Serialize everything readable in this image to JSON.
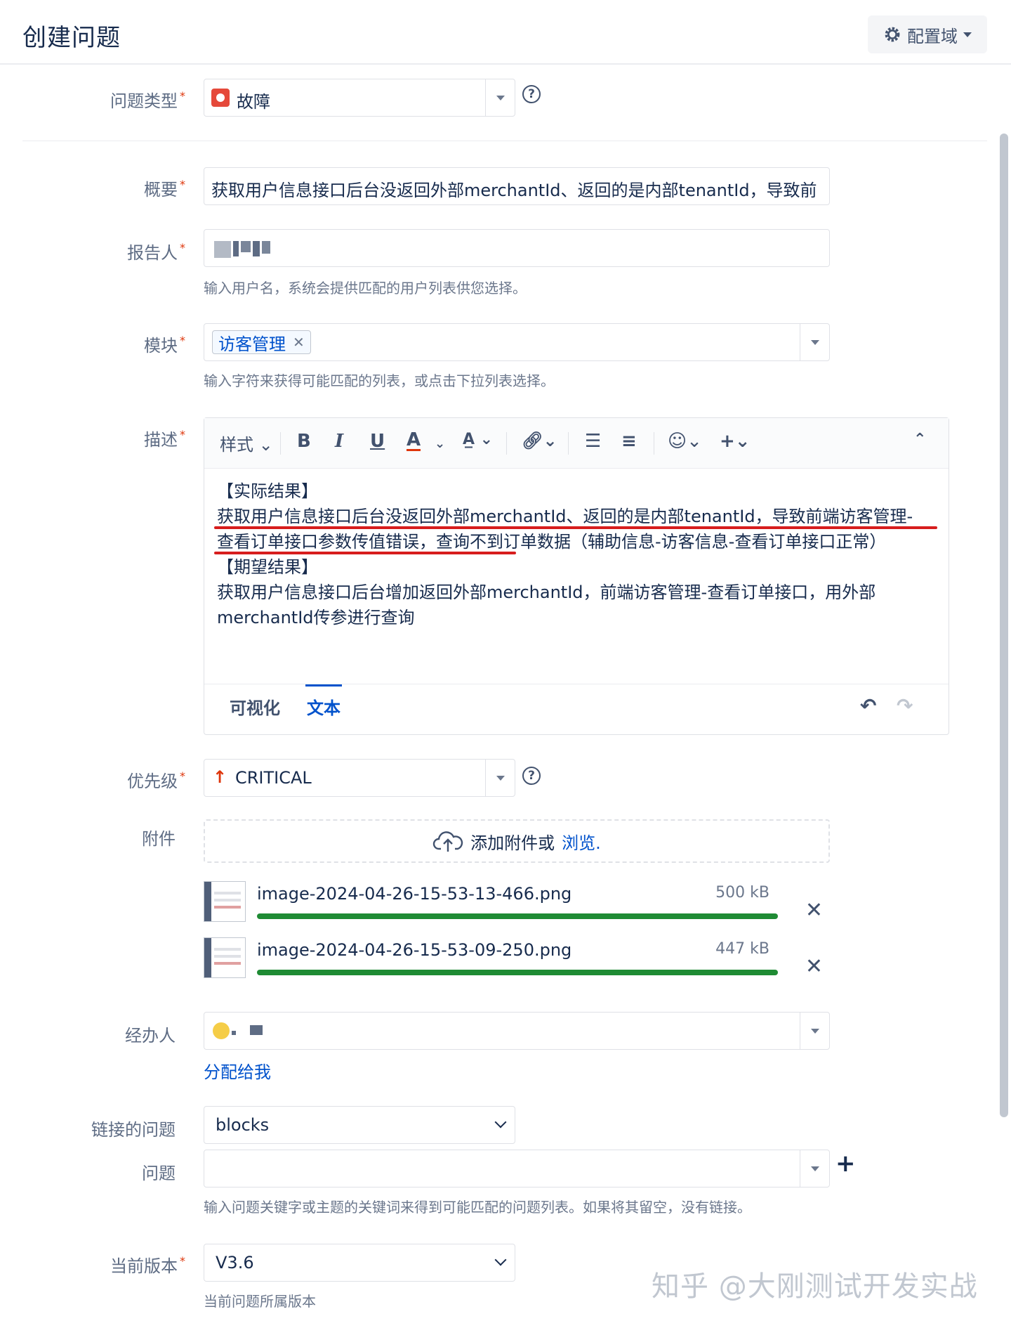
{
  "header": {
    "title": "创建问题",
    "config_label": "配置域"
  },
  "issue_type": {
    "label": "问题类型",
    "value": "故障"
  },
  "summary": {
    "label": "概要",
    "value": "获取用户信息接口后台没返回外部merchantId、返回的是内部tenantId，导致前"
  },
  "reporter": {
    "label": "报告人",
    "hint": "输入用户名，系统会提供匹配的用户列表供您选择。"
  },
  "module": {
    "label": "模块",
    "tag": "访客管理",
    "hint": "输入字符来获得可能匹配的列表，或点击下拉列表选择。"
  },
  "description": {
    "label": "描述",
    "toolbar": {
      "style_label": "样式"
    },
    "lines": [
      "【实际结果】",
      "获取用户信息接口后台没返回外部merchantId、返回的是内部tenantId，导致前端访客管理-",
      "查看订单接口参数传值错误，查询不到订单数据（辅助信息-访客信息-查看订单接口正常）",
      "【期望结果】",
      "获取用户信息接口后台增加返回外部merchantId，前端访客管理-查看订单接口，用外部",
      "merchantId传参进行查询"
    ],
    "tabs": {
      "visual": "可视化",
      "text": "文本"
    }
  },
  "priority": {
    "label": "优先级",
    "value": "CRITICAL"
  },
  "attachments": {
    "label": "附件",
    "drop_text": "添加附件或",
    "browse": "浏览.",
    "files": [
      {
        "name": "image-2024-04-26-15-53-13-466.png",
        "size": "500 kB",
        "progress": 100
      },
      {
        "name": "image-2024-04-26-15-53-09-250.png",
        "size": "447 kB",
        "progress": 100
      }
    ]
  },
  "assignee": {
    "label": "经办人",
    "assign_me": "分配给我"
  },
  "linked_issues": {
    "label": "链接的问题",
    "value": "blocks"
  },
  "issue": {
    "label": "问题",
    "value": "",
    "hint": "输入问题关键字或主题的关键词来得到可能匹配的问题列表。如果将其留空，没有链接。"
  },
  "version": {
    "label": "当前版本",
    "value": "V3.6",
    "hint": "当前问题所属版本"
  },
  "watermark": "知乎 @大刚测试开发实战",
  "colors": {
    "accent": "#0052cc",
    "required": "#de350b",
    "progress": "#1f8b34",
    "bug": "#e5493a",
    "annotation": "#d71d1d"
  }
}
